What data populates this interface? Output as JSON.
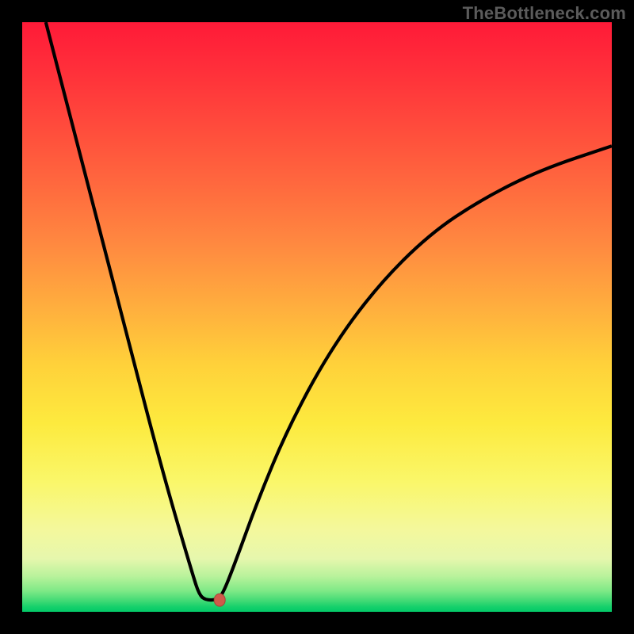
{
  "watermark": "TheBottleneck.com",
  "chart_data": {
    "type": "line",
    "title": "",
    "xlabel": "",
    "ylabel": "",
    "xlim": [
      0,
      1
    ],
    "ylim": [
      0,
      1
    ],
    "grid": false,
    "series": [
      {
        "name": "curve",
        "points": [
          {
            "x": 0.04,
            "y": 1.0
          },
          {
            "x": 0.11,
            "y": 0.73
          },
          {
            "x": 0.18,
            "y": 0.46
          },
          {
            "x": 0.24,
            "y": 0.23
          },
          {
            "x": 0.29,
            "y": 0.06
          },
          {
            "x": 0.3,
            "y": 0.03
          },
          {
            "x": 0.31,
            "y": 0.02
          },
          {
            "x": 0.33,
            "y": 0.02
          },
          {
            "x": 0.34,
            "y": 0.03
          },
          {
            "x": 0.36,
            "y": 0.08
          },
          {
            "x": 0.4,
            "y": 0.19
          },
          {
            "x": 0.45,
            "y": 0.31
          },
          {
            "x": 0.52,
            "y": 0.44
          },
          {
            "x": 0.6,
            "y": 0.55
          },
          {
            "x": 0.69,
            "y": 0.64
          },
          {
            "x": 0.78,
            "y": 0.7
          },
          {
            "x": 0.88,
            "y": 0.75
          },
          {
            "x": 1.0,
            "y": 0.79
          }
        ]
      }
    ],
    "marker": {
      "x": 0.335,
      "y": 0.02
    }
  }
}
